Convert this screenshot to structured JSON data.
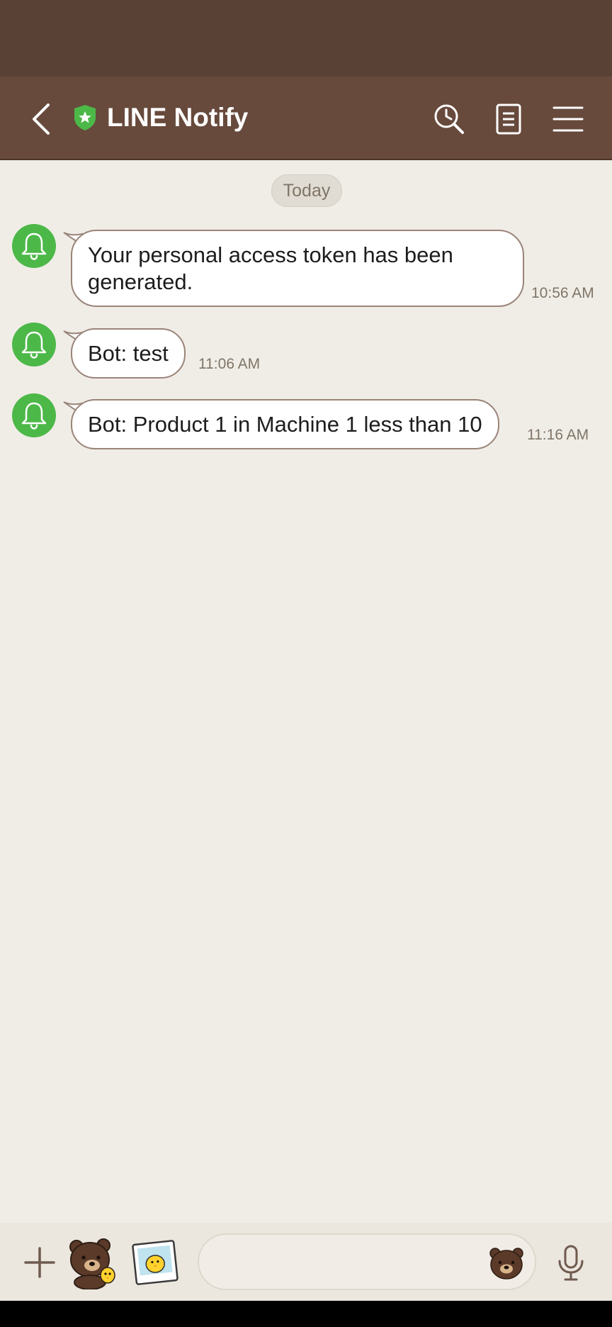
{
  "header": {
    "title": "LINE Notify",
    "icons": [
      "chevron-left-icon",
      "shield-star-icon",
      "search-clock-icon",
      "notes-icon",
      "hamburger-menu-icon"
    ]
  },
  "chat": {
    "date_separator": "Today",
    "messages": [
      {
        "sender_icon": "bell-icon",
        "text": "Your personal access token has been generated.",
        "time": "10:56 AM"
      },
      {
        "sender_icon": "bell-icon",
        "text": "Bot: test",
        "time": "11:06 AM"
      },
      {
        "sender_icon": "bell-icon",
        "text": "Bot: Product 1 in Machine 1 less than 10",
        "time": "11:16 AM"
      }
    ]
  },
  "composer": {
    "input_value": "",
    "input_placeholder": "",
    "icons": [
      "plus-icon",
      "sticker-icon",
      "photo-icon",
      "emoji-icon",
      "microphone-icon"
    ]
  },
  "colors": {
    "status_bar": "#5a4136",
    "header": "#674a3c",
    "chat_background": "#f0ede7",
    "bubble_border": "#9a8479",
    "avatar": "#4cb848"
  }
}
